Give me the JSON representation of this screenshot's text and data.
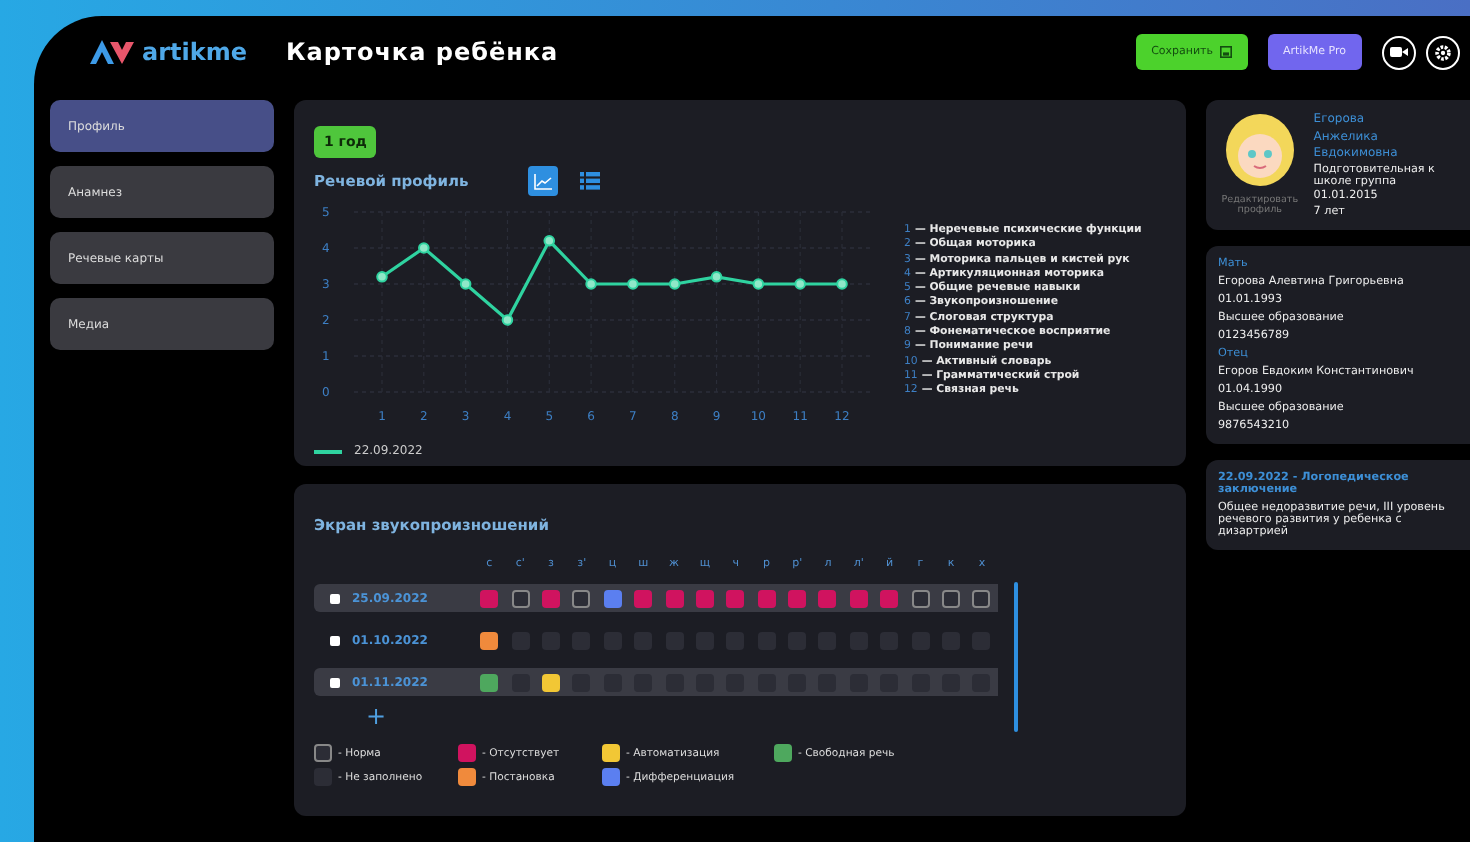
{
  "app": {
    "logo": "artikme",
    "title": "Карточка ребёнка"
  },
  "header_buttons": [
    {
      "kind": "save",
      "label": "Сохранить"
    },
    {
      "kind": "pro",
      "label": "ArtikMe Pro"
    }
  ],
  "sidebar": {
    "items": [
      {
        "label": "Профиль",
        "selected": true
      },
      {
        "label": "Анамнез",
        "selected": false
      },
      {
        "label": "Речевые карты",
        "selected": false
      },
      {
        "label": "Медиа",
        "selected": false
      }
    ]
  },
  "age_badge": "1 год",
  "speech_profile": {
    "title": "Речевой профиль",
    "view_toggle": [
      {
        "kind": "chart",
        "selected": true
      },
      {
        "kind": "list",
        "selected": false
      }
    ],
    "chart_data": {
      "type": "line",
      "grid": true,
      "categories": [
        "1",
        "2",
        "3",
        "4",
        "5",
        "6",
        "7",
        "8",
        "9",
        "10",
        "11",
        "12"
      ],
      "series": [
        {
          "name": "22.09.2022",
          "color": "#2fd3a0",
          "marker": "circle",
          "values": [
            3.2,
            4,
            3,
            2,
            4.2,
            3,
            3,
            3,
            3.2,
            3,
            3,
            3
          ]
        }
      ],
      "ylim": [
        0,
        5
      ],
      "yticks": [
        0,
        1,
        2,
        3,
        4,
        5
      ]
    },
    "legend": [
      {
        "number": "1",
        "text": "— Неречевые психические функции"
      },
      {
        "number": "2",
        "text": "— Общая моторика"
      },
      {
        "number": "3",
        "text": "— Моторика пальцев и кистей рук"
      },
      {
        "number": "4",
        "text": "— Артикуляционная моторика"
      },
      {
        "number": "5",
        "text": "— Общие речевые навыки"
      },
      {
        "number": "6",
        "text": "— Звукопроизношение"
      },
      {
        "number": "7",
        "text": "— Слоговая структура"
      },
      {
        "number": "8",
        "text": "— Фонематическое восприятие"
      },
      {
        "number": "9",
        "text": "— Понимание речи"
      },
      {
        "number": "10",
        "text": "— Активный словарь"
      },
      {
        "number": "11",
        "text": "— Грамматический строй"
      },
      {
        "number": "12",
        "text": "— Связная речь"
      }
    ]
  },
  "sound_screen": {
    "title": "Экран звукопроизношений",
    "sounds": [
      "с",
      "с'",
      "з",
      "з'",
      "ц",
      "ш",
      "ж",
      "щ",
      "ч",
      "р",
      "р'",
      "л",
      "л'",
      "й",
      "г",
      "к",
      "х"
    ],
    "rows": [
      {
        "date": "25.09.2022",
        "checked": false,
        "cells": [
          {
            "kind": "absent"
          },
          {
            "kind": "norm"
          },
          {
            "kind": "absent"
          },
          {
            "kind": "norm"
          },
          {
            "kind": "diff"
          },
          {
            "kind": "absent"
          },
          {
            "kind": "absent"
          },
          {
            "kind": "absent"
          },
          {
            "kind": "absent"
          },
          {
            "kind": "absent"
          },
          {
            "kind": "absent"
          },
          {
            "kind": "absent"
          },
          {
            "kind": "absent"
          },
          {
            "kind": "absent"
          },
          {
            "kind": "norm"
          },
          {
            "kind": "norm"
          },
          {
            "kind": "norm"
          }
        ]
      },
      {
        "date": "01.10.2022",
        "checked": false,
        "cells": [
          {
            "kind": "setting"
          },
          {
            "kind": "empty"
          },
          {
            "kind": "empty"
          },
          {
            "kind": "empty"
          },
          {
            "kind": "empty"
          },
          {
            "kind": "empty"
          },
          {
            "kind": "empty"
          },
          {
            "kind": "empty"
          },
          {
            "kind": "empty"
          },
          {
            "kind": "empty"
          },
          {
            "kind": "empty"
          },
          {
            "kind": "empty"
          },
          {
            "kind": "empty"
          },
          {
            "kind": "empty"
          },
          {
            "kind": "empty"
          },
          {
            "kind": "empty"
          },
          {
            "kind": "empty"
          }
        ]
      },
      {
        "date": "01.11.2022",
        "checked": false,
        "cells": [
          {
            "kind": "free"
          },
          {
            "kind": "empty"
          },
          {
            "kind": "auto"
          },
          {
            "kind": "empty"
          },
          {
            "kind": "empty"
          },
          {
            "kind": "empty"
          },
          {
            "kind": "empty"
          },
          {
            "kind": "empty"
          },
          {
            "kind": "empty"
          },
          {
            "kind": "empty"
          },
          {
            "kind": "empty"
          },
          {
            "kind": "empty"
          },
          {
            "kind": "empty"
          },
          {
            "kind": "empty"
          },
          {
            "kind": "empty"
          },
          {
            "kind": "empty"
          },
          {
            "kind": "empty"
          }
        ]
      }
    ],
    "add_label": "+",
    "legend": [
      {
        "kind": "norm",
        "label": "- Норма"
      },
      {
        "kind": "empty",
        "label": "- Не заполнено"
      },
      {
        "kind": "absent",
        "label": "- Отсутствует"
      },
      {
        "kind": "setting",
        "label": "- Постановка"
      },
      {
        "kind": "auto",
        "label": "- Автоматизация"
      },
      {
        "kind": "diff",
        "label": "- Дифференциация"
      },
      {
        "kind": "free",
        "label": "- Свободная речь"
      }
    ]
  },
  "child": {
    "edit_label": "Редактировать профиль",
    "name_lines": [
      "Егорова",
      "Анжелика",
      "Евдокимовна"
    ],
    "info_lines": [
      "Подготовительная к школе группа",
      "01.01.2015",
      "7 лет"
    ]
  },
  "parents": [
    {
      "role": "Мать",
      "lines": [
        "Егорова Алевтина Григорьевна",
        "01.01.1993",
        "Высшее образование",
        "0123456789"
      ]
    },
    {
      "role": "Отец",
      "lines": [
        "Егоров Евдоким Константинович",
        "01.04.1990",
        "Высшее образование",
        "9876543210"
      ]
    }
  ],
  "conclusion": {
    "title": "22.09.2022 - Логопедическое заключение",
    "text": "Общее недоразвитие речи, III уровень речевого развития у ребенка с дизартрией"
  }
}
